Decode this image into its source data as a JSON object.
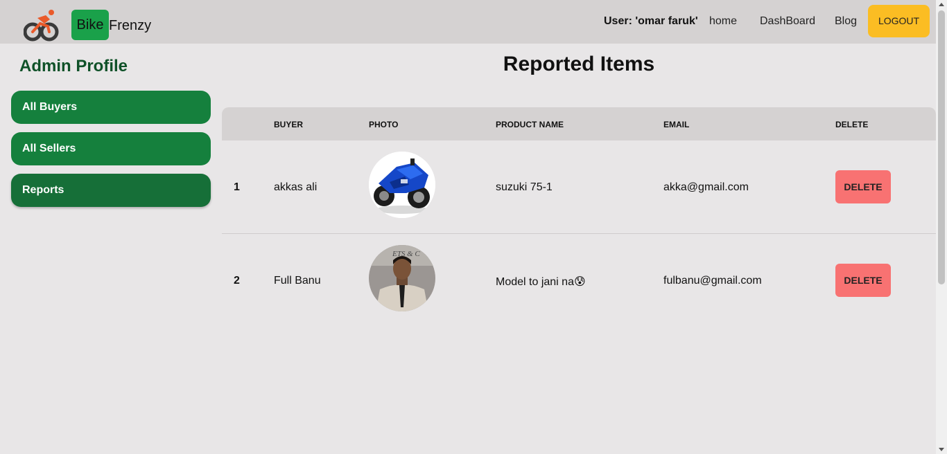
{
  "navbar": {
    "brand_first": "Bike",
    "brand_second": "Frenzy",
    "user_label": "User: 'omar faruk'",
    "links": [
      "home",
      "DashBoard",
      "Blog"
    ],
    "logout_label": "LOGOUT",
    "logo_icon": "cyclist-icon"
  },
  "sidebar": {
    "title": "Admin Profile",
    "items": [
      {
        "label": "All Buyers"
      },
      {
        "label": "All Sellers"
      },
      {
        "label": "Reports"
      }
    ],
    "active": "Reports"
  },
  "main": {
    "title": "Reported Items",
    "columns": [
      "",
      "BUYER",
      "PHOTO",
      "PRODUCT NAME",
      "EMAIL",
      "DELETE"
    ],
    "rows": [
      {
        "num": "1",
        "buyer": "akkas ali",
        "photo": "motorcycle-photo",
        "product": "suzuki 75-1",
        "email": "akka@gmail.com",
        "delete_label": "DELETE"
      },
      {
        "num": "2",
        "buyer": "Full Banu",
        "photo": "person-photo",
        "product": "Model to jani na😰",
        "email": "fulbanu@gmail.com",
        "delete_label": "DELETE"
      }
    ]
  },
  "colors": {
    "navbar_bg": "#d5d2d2",
    "page_bg": "#e8e6e7",
    "brand_green": "#1aa14a",
    "sidebar_button": "#15803d",
    "logout_yellow": "#fbbd23",
    "delete_red": "#f87272",
    "sidebar_title": "#0f5128"
  }
}
